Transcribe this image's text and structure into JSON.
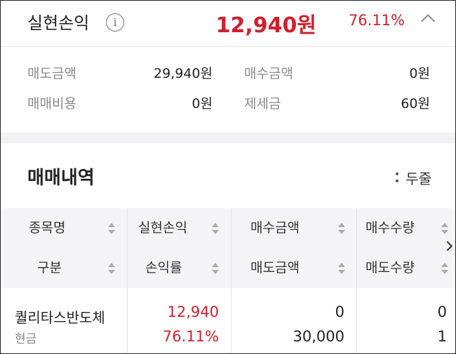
{
  "summary": {
    "title": "실현손익",
    "info_icon": "info-icon",
    "info_glyph": "i",
    "amount": "12,940원",
    "rate": "76.11%",
    "accent": "#d0202f",
    "collapse_icon": "chevron-up-icon"
  },
  "details": {
    "sell_amount_label": "매도금액",
    "sell_amount_value": "29,940원",
    "buy_amount_label": "매수금액",
    "buy_amount_value": "0원",
    "trade_cost_label": "매매비용",
    "trade_cost_value": "0원",
    "tax_label": "제세금",
    "tax_value": "60원"
  },
  "history": {
    "title": "매매내역",
    "view_toggle_label": "두줄"
  },
  "table": {
    "headers_row1": [
      "종목명",
      "실현손익",
      "매수금액",
      "매수수량"
    ],
    "headers_row2": [
      "구분",
      "손익률",
      "매도금액",
      "매도수량"
    ],
    "rows": [
      {
        "name": "퀄리타스반도체",
        "type": "현금",
        "realized_pnl": "12,940",
        "pnl_rate": "76.11%",
        "buy_amount": "0",
        "sell_amount": "30,000",
        "buy_qty": "0",
        "sell_qty": "1"
      }
    ]
  }
}
